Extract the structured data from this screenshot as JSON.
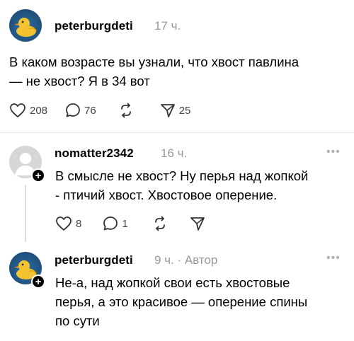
{
  "post1": {
    "username": "peterburgdeti",
    "time": "17 ч.",
    "text_line1": "В каком возрасте вы узнали, что хвост павлина",
    "text_line2": "— не хвост? Я в 34 вот",
    "likes": "208",
    "comments": "76",
    "shares": "25"
  },
  "post2": {
    "username": "nomatter2342",
    "time": "16 ч.",
    "more": "•••",
    "text_line1": "В смысле не хвост? Ну перья над жопкой",
    "text_line2": "- птичий хвост. Хвостовое оперение.",
    "likes": "8",
    "comments": "1"
  },
  "post3": {
    "username": "peterburgdeti",
    "time": "9 ч. · Автор",
    "more": "•••",
    "text_line1": "Не-а, над жопкой свои есть хвостовые",
    "text_line2": "перья, а это красивое — оперение спины",
    "text_line3": "по сути"
  },
  "icons": {
    "like": "heart-icon",
    "comment": "comment-bubble-icon",
    "repost": "repost-icon",
    "share": "send-icon",
    "follow": "plus-icon"
  }
}
